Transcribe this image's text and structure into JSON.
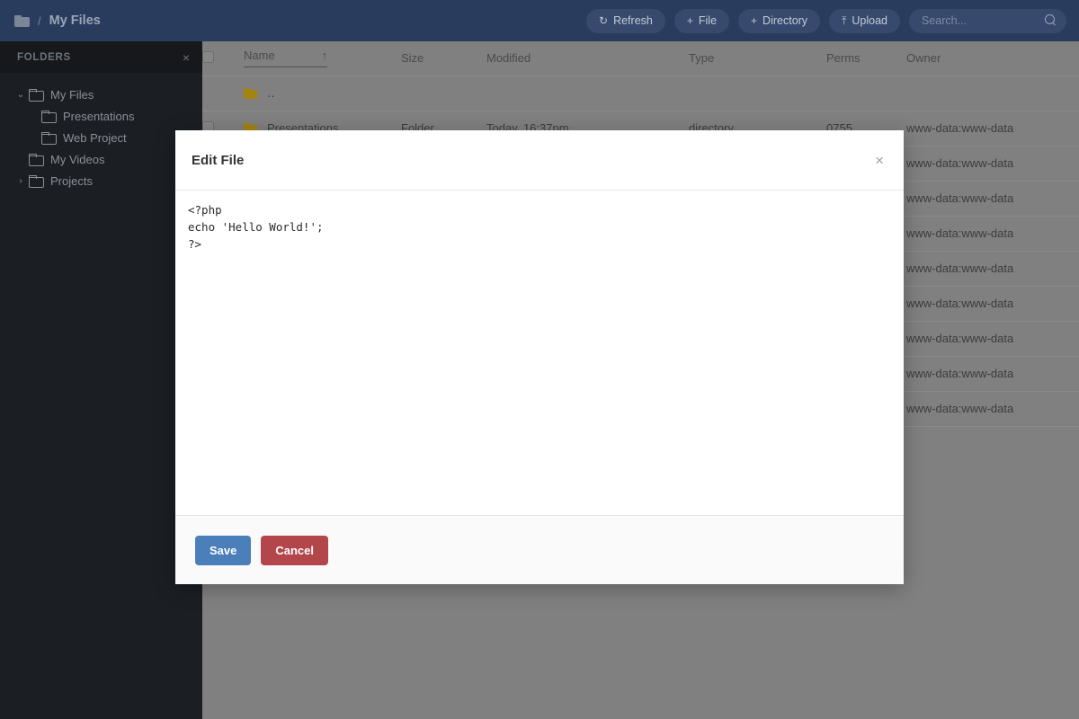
{
  "topbar": {
    "folder_icon": "folder-icon",
    "separator": "/",
    "title": "My Files",
    "buttons": [
      {
        "label": "Refresh",
        "icon": "↻",
        "name": "refresh-button"
      },
      {
        "label": "File",
        "icon": "+",
        "name": "new-file-button"
      },
      {
        "label": "Directory",
        "icon": "+",
        "name": "new-directory-button"
      },
      {
        "label": "Upload",
        "icon": "⤒",
        "name": "upload-button"
      }
    ],
    "search": {
      "value": "",
      "placeholder": "Search..."
    }
  },
  "sidebar": {
    "header": "FOLDERS",
    "close_label": "×",
    "items": [
      {
        "label": "My Files",
        "level": 0,
        "chevron": "⌄",
        "expanded": true
      },
      {
        "label": "Presentations",
        "level": 1,
        "chevron": "",
        "expanded": false
      },
      {
        "label": "Web Project",
        "level": 1,
        "chevron": "",
        "expanded": false
      },
      {
        "label": "My Videos",
        "level": 0,
        "chevron": "",
        "expanded": false
      },
      {
        "label": "Projects",
        "level": 0,
        "chevron": "›",
        "expanded": false
      }
    ]
  },
  "table": {
    "columns": [
      "Name",
      "Size",
      "Modified",
      "Type",
      "Perms",
      "Owner"
    ],
    "sort_indicator": "↑",
    "sorted_column": "Name",
    "parent_row": {
      "name": "..",
      "display": "‥"
    },
    "rows": [
      {
        "name": "Presentations",
        "size": "Folder",
        "modified": "Today, 16:37pm",
        "type": "directory",
        "perms": "0755",
        "owner": "www-data:www-data"
      },
      {
        "name": "",
        "size": "",
        "modified": "",
        "type": "",
        "perms": "",
        "owner": "www-data:www-data"
      },
      {
        "name": "",
        "size": "",
        "modified": "",
        "type": "",
        "perms": "",
        "owner": "www-data:www-data"
      },
      {
        "name": "",
        "size": "",
        "modified": "",
        "type": "",
        "perms": "",
        "owner": "www-data:www-data"
      },
      {
        "name": "",
        "size": "",
        "modified": "",
        "type": "",
        "perms": "",
        "owner": "www-data:www-data"
      },
      {
        "name": "",
        "size": "",
        "modified": "",
        "type": "",
        "perms": "",
        "owner": "www-data:www-data"
      },
      {
        "name": "",
        "size": "",
        "modified": "",
        "type": "",
        "perms": "",
        "owner": "www-data:www-data"
      },
      {
        "name": "",
        "size": "",
        "modified": "",
        "type": "",
        "perms": "",
        "owner": "www-data:www-data"
      },
      {
        "name": "",
        "size": "",
        "modified": "",
        "type": "",
        "perms": "",
        "owner": "www-data:www-data"
      }
    ]
  },
  "modal": {
    "title": "Edit File",
    "close_label": "×",
    "editor_content": "<?php\necho 'Hello World!';\n?>",
    "save_label": "Save",
    "cancel_label": "Cancel"
  },
  "colors": {
    "topbar": "#2a3c5e",
    "sidebar": "#1b1e23",
    "backdrop": "#808080",
    "folder_icon": "#a38410",
    "save_button": "#4a7fba",
    "cancel_button": "#b2464a"
  }
}
